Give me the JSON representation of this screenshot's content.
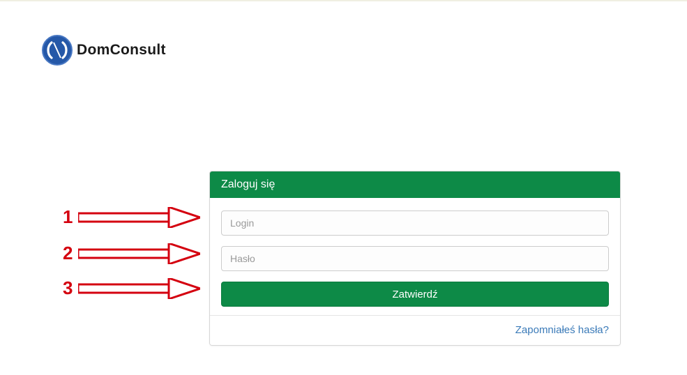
{
  "brand": {
    "name": "DomConsult"
  },
  "login": {
    "header": "Zaloguj się",
    "login_placeholder": "Login",
    "password_placeholder": "Hasło",
    "submit_label": "Zatwierdź",
    "forgot_label": "Zapomniałeś hasła?"
  },
  "annotations": {
    "a1": "1",
    "a2": "2",
    "a3": "3"
  },
  "colors": {
    "brand_green": "#0d8a47",
    "brand_blue": "#2558a8",
    "annotation_red": "#d4000f",
    "link_blue": "#3a7ab8"
  }
}
